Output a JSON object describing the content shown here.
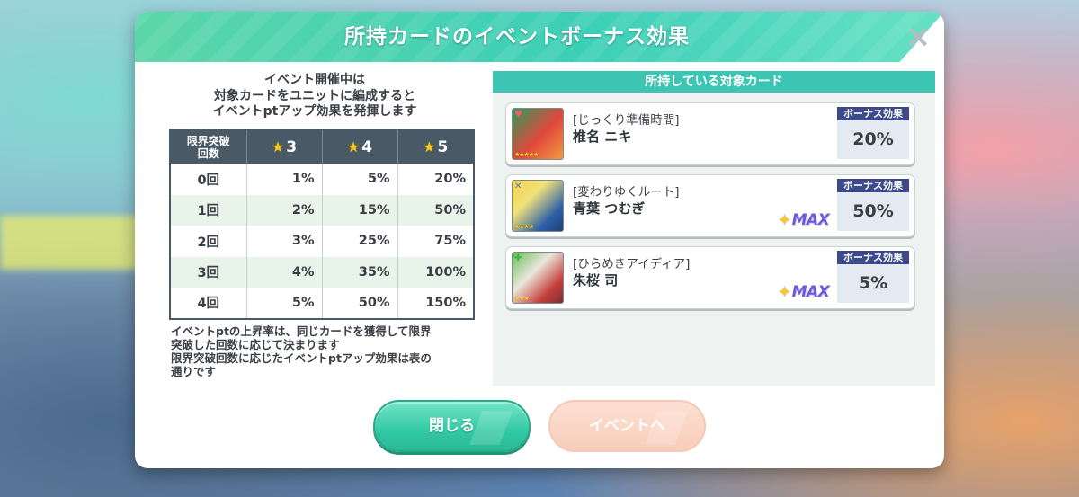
{
  "dialog": {
    "title": "所持カードのイベントボーナス効果",
    "close_icon": "×"
  },
  "intro": {
    "line1": "イベント開催中は",
    "line2": "対象カードをユニットに編成すると",
    "line3": "イベントptアップ効果を発揮します"
  },
  "table": {
    "header_row_label_line1": "限界突破",
    "header_row_label_line2": "回数",
    "star_icon": "★",
    "columns": [
      "3",
      "4",
      "5"
    ],
    "rows": [
      {
        "label": "0回",
        "values": [
          "1%",
          "5%",
          "20%"
        ]
      },
      {
        "label": "1回",
        "values": [
          "2%",
          "15%",
          "50%"
        ]
      },
      {
        "label": "2回",
        "values": [
          "3%",
          "25%",
          "75%"
        ]
      },
      {
        "label": "3回",
        "values": [
          "4%",
          "35%",
          "100%"
        ]
      },
      {
        "label": "4回",
        "values": [
          "5%",
          "50%",
          "150%"
        ]
      }
    ]
  },
  "note": {
    "line1": "イベントptの上昇率は、同じカードを獲得して限界",
    "line2": "突破した回数に応じて決まります",
    "line3": "限界突破回数に応じたイベントptアップ効果は表の",
    "line4": "通りです"
  },
  "owned": {
    "header": "所持している対象カード",
    "bonus_label": "ボーナス効果",
    "max_label": "MAX",
    "cards": [
      {
        "title": "[じっくり準備時間]",
        "name": "椎名 ニキ",
        "bonus": "20%",
        "max": false,
        "colors": [
          "#e0473c",
          "#2f9a5a"
        ]
      },
      {
        "title": "[変わりゆくルート]",
        "name": "青葉 つむぎ",
        "bonus": "50%",
        "max": true,
        "colors": [
          "#f4d34a",
          "#2d5fa8"
        ]
      },
      {
        "title": "[ひらめきアイディア]",
        "name": "朱桜 司",
        "bonus": "5%",
        "max": true,
        "colors": [
          "#6bbf59",
          "#c7403c"
        ]
      }
    ]
  },
  "buttons": {
    "close": "閉じる",
    "event": "イベントへ"
  }
}
